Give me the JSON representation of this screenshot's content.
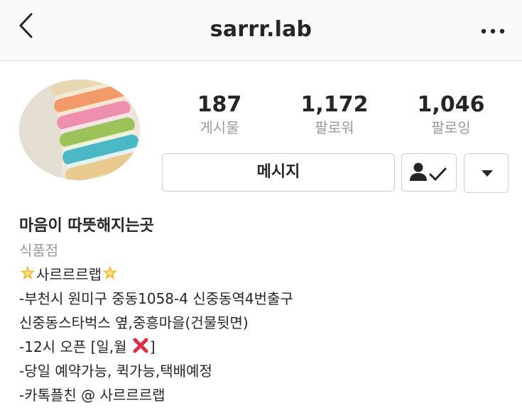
{
  "header": {
    "username": "sarrr.lab",
    "back_icon": "chevron-left-icon",
    "more_icon": "more-horizontal-icon"
  },
  "profile": {
    "avatar_icon": "macaron-stack-photo",
    "stats": [
      {
        "value": "187",
        "label": "게시물"
      },
      {
        "value": "1,172",
        "label": "팔로워"
      },
      {
        "value": "1,046",
        "label": "팔로잉"
      }
    ]
  },
  "actions": {
    "message_label": "메시지",
    "following_icon": "person-check-icon",
    "dropdown_icon": "caret-down-icon"
  },
  "bio": {
    "display_name": "마음이 따뜻해지는곳",
    "category": "식품점",
    "brand": "사르르르랩",
    "address_line": "-부천시 원미구 중동1058-4 신중동역4번출구",
    "landmark_line": "신중동스타벅스 옆,중흥마을(건물뒷면)",
    "hours_line": "-12시 오픈 [일,월",
    "hours_close": "]",
    "reservation_line": "-당일 예약가능, 퀵가능,택배예정",
    "kakao_line": "-카톡플친 @ 사르르르랩"
  },
  "colors": {
    "text": "#262626",
    "secondary": "#999999",
    "border": "#cfcfcf",
    "header_bg": "#fafafa",
    "x_mark": "#dd2e44",
    "star": "#f5b82e"
  }
}
